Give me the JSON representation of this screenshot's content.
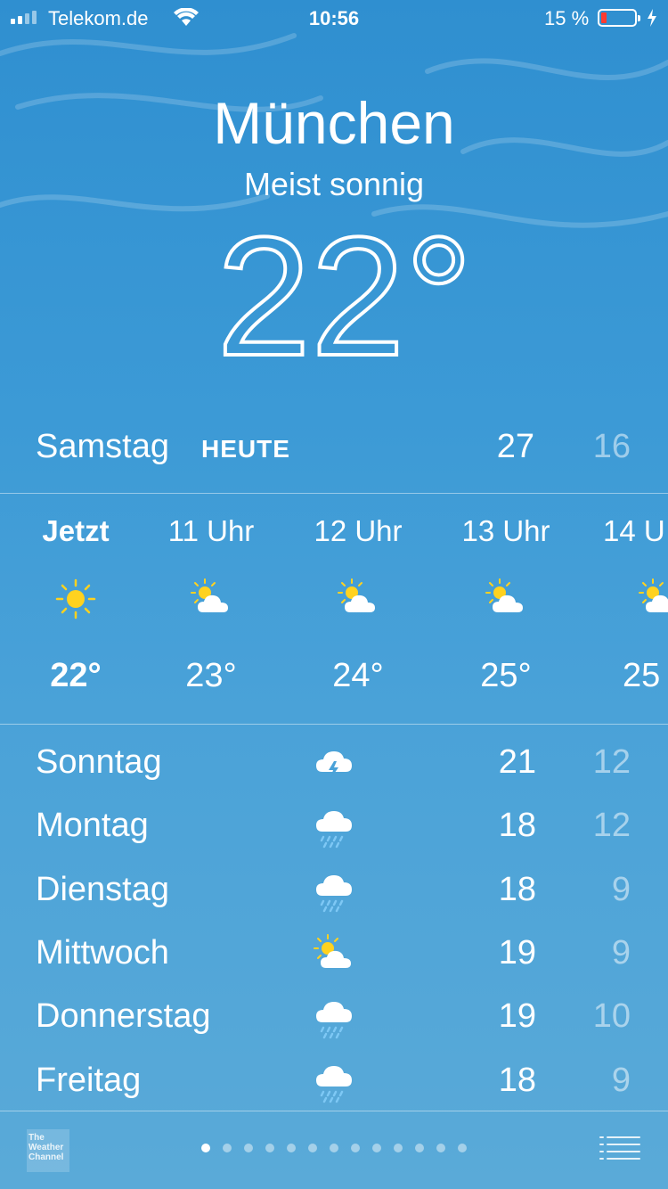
{
  "status": {
    "carrier": "Telekom.de",
    "time": "10:56",
    "battery": "15 %"
  },
  "header": {
    "city": "München",
    "condition": "Meist sonnig",
    "temperature": "22°"
  },
  "today": {
    "day": "Samstag",
    "badge": "HEUTE",
    "high": "27",
    "low": "16"
  },
  "hourly": [
    {
      "label": "Jetzt",
      "temp": "22°",
      "icon": "sun-icon"
    },
    {
      "label": "11 Uhr",
      "temp": "23°",
      "icon": "partly-sunny-icon"
    },
    {
      "label": "12 Uhr",
      "temp": "24°",
      "icon": "partly-sunny-icon"
    },
    {
      "label": "13 Uhr",
      "temp": "25°",
      "icon": "partly-sunny-icon"
    },
    {
      "label": "14 U",
      "temp": "25",
      "icon": "partly-sunny-icon"
    }
  ],
  "daily": [
    {
      "day": "Sonntag",
      "icon": "thunderstorm-icon",
      "high": "21",
      "low": "12"
    },
    {
      "day": "Montag",
      "icon": "rain-icon",
      "high": "18",
      "low": "12"
    },
    {
      "day": "Dienstag",
      "icon": "rain-icon",
      "high": "18",
      "low": "9"
    },
    {
      "day": "Mittwoch",
      "icon": "partly-sunny-icon",
      "high": "19",
      "low": "9"
    },
    {
      "day": "Donnerstag",
      "icon": "rain-icon",
      "high": "19",
      "low": "10"
    },
    {
      "day": "Freitag",
      "icon": "rain-icon",
      "high": "18",
      "low": "9"
    }
  ],
  "bottom": {
    "logo_text": "The Weather Channel",
    "page_count": 13,
    "active_page": 0
  },
  "colors": {
    "background": "#3c9ad6",
    "sun": "#ffd21f",
    "battery_low": "#ff3b30"
  }
}
